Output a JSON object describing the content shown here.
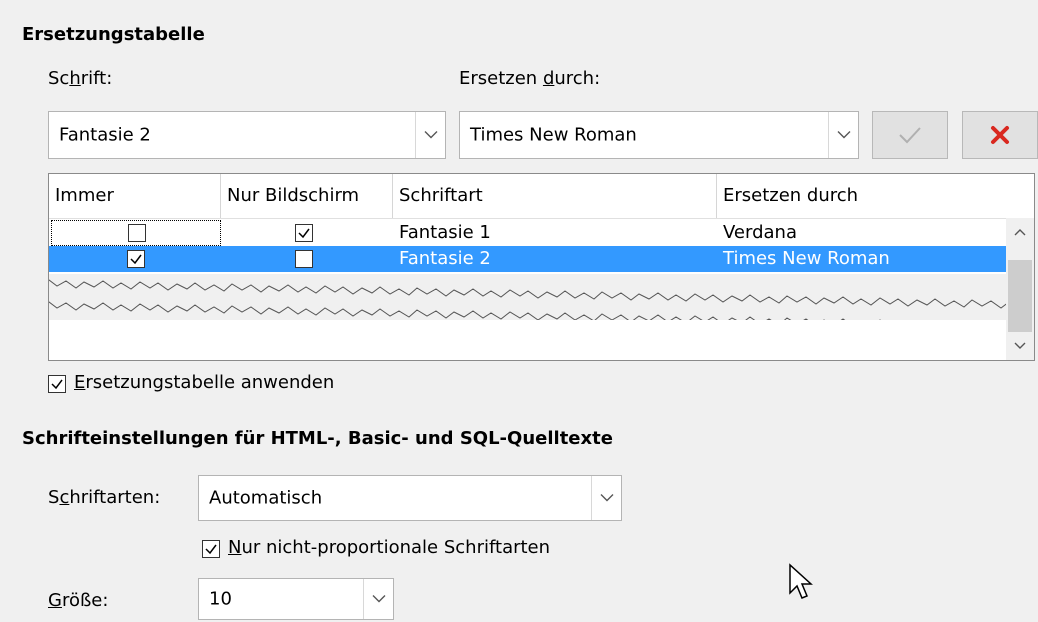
{
  "section_replace": {
    "title": "Ersetzungstabelle",
    "font_label_pre": "Sc",
    "font_label_u": "h",
    "font_label_post": "rift:",
    "replace_label_pre": "Ersetzen ",
    "replace_label_u": "d",
    "replace_label_post": "urch:",
    "font_value": "Fantasie 2",
    "replace_value": "Times New Roman",
    "table": {
      "headers": [
        "Immer",
        "Nur Bildschirm",
        "Schriftart",
        "Ersetzen durch"
      ],
      "rows": [
        {
          "always": false,
          "screen_only": true,
          "font": "Fantasie 1",
          "replace": "Verdana",
          "selected": false
        },
        {
          "always": true,
          "screen_only": false,
          "font": "Fantasie 2",
          "replace": "Times New Roman",
          "selected": true
        }
      ]
    },
    "apply_label_u": "E",
    "apply_label_rest": "rsetzungstabelle anwenden",
    "apply_checked": true
  },
  "section_source": {
    "title": "Schrifteinstellungen für HTML-, Basic- und SQL-Quelltexte",
    "fonts_label_pre": "S",
    "fonts_label_u": "c",
    "fonts_label_post": "hriftarten:",
    "fonts_value": "Automatisch",
    "nonprop_label_u": "N",
    "nonprop_label_rest": "ur nicht-proportionale Schriftarten",
    "nonprop_checked": true,
    "size_label_u": "G",
    "size_label_rest": "röße:",
    "size_value": "10"
  },
  "colors": {
    "selection": "#3399ff",
    "delete_icon": "#d9281f"
  }
}
